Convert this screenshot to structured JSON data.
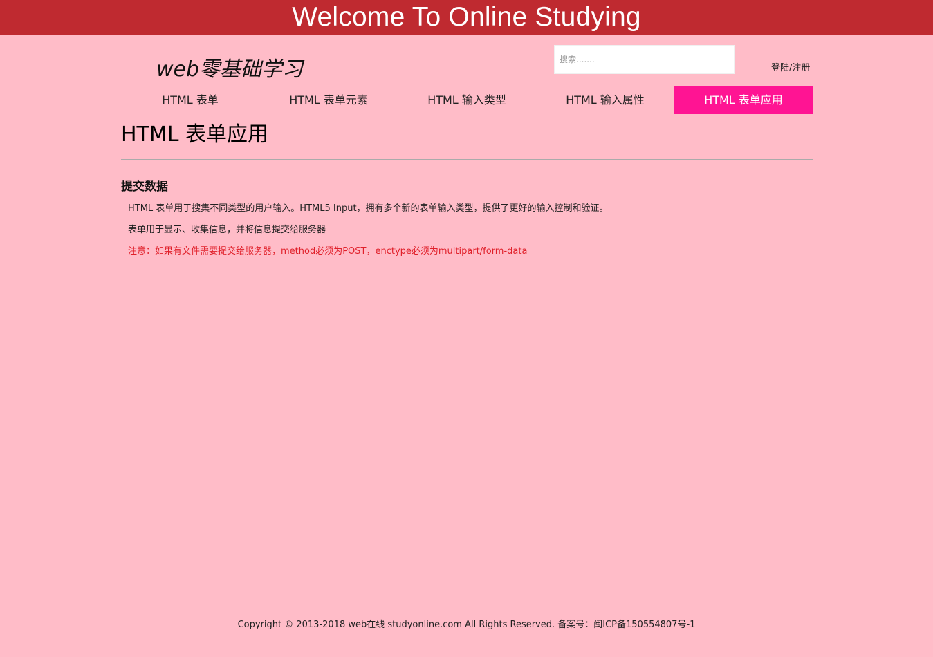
{
  "banner": {
    "title": "Welcome To Online Studying"
  },
  "header": {
    "brand": "web零基础学习",
    "search_placeholder": "搜索.......",
    "auth_link": "登陆/注册"
  },
  "nav": {
    "items": [
      {
        "label": "HTML 表单",
        "active": false
      },
      {
        "label": "HTML 表单元素",
        "active": false
      },
      {
        "label": "HTML 输入类型",
        "active": false
      },
      {
        "label": "HTML 输入属性",
        "active": false
      },
      {
        "label": "HTML 表单应用",
        "active": true
      }
    ],
    "active_color": "#ff1493"
  },
  "main": {
    "page_title": "HTML 表单应用",
    "section_heading": "提交数据",
    "paragraphs": [
      "HTML 表单用于搜集不同类型的用户输入。HTML5 Input，拥有多个新的表单输入类型，提供了更好的输入控制和验证。",
      "表单用于显示、收集信息，并将信息提交给服务器",
      "注意：如果有文件需要提交给服务器，method必须为POST，enctype必须为multipart/form-data"
    ],
    "note_color": "#e0202a"
  },
  "footer": {
    "copyright": "Copyright © 2013-2018 web在线 studyonline.com All Rights Reserved. 备案号：闽ICP备150554807号-1"
  },
  "colors": {
    "page_background": "#ffbcc8",
    "banner_background": "#bf2a30"
  }
}
